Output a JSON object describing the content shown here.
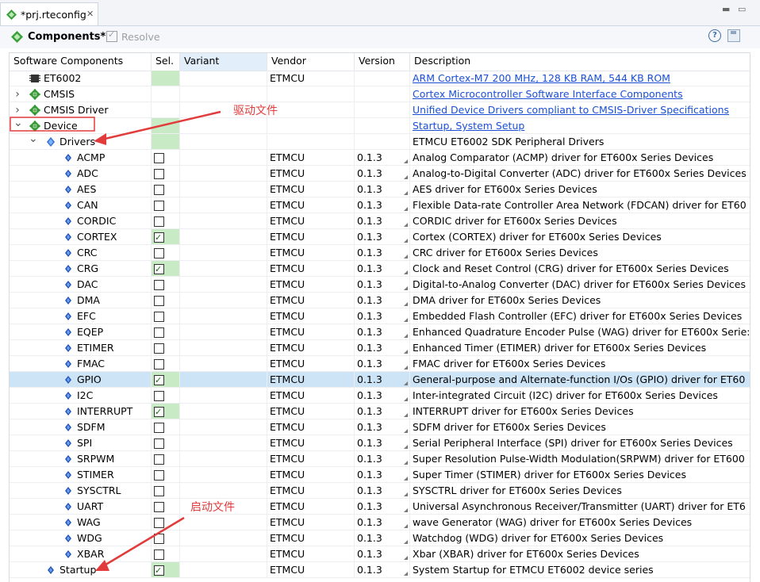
{
  "tab": {
    "title": "*prj.rteconfig",
    "close": "✕"
  },
  "header": {
    "title": "Components*",
    "resolve": "Resolve"
  },
  "columns": [
    "Software Components",
    "Sel.",
    "Variant",
    "Vendor",
    "Version",
    "Description"
  ],
  "rows": [
    {
      "name": "ET6002",
      "level": 0,
      "icon": "chip-icon",
      "expander": "",
      "sel": "green",
      "vendor": "ETMCU",
      "version": "",
      "desc": "ARM Cortex-M7 200 MHz, 128 KB RAM, 544 KB ROM",
      "link": true
    },
    {
      "name": "CMSIS",
      "level": 0,
      "icon": "component-diamond-icon",
      "expander": ">",
      "sel": "",
      "vendor": "",
      "version": "",
      "desc": "Cortex Microcontroller Software Interface Components",
      "link": true
    },
    {
      "name": "CMSIS Driver",
      "level": 0,
      "icon": "component-diamond-icon",
      "expander": ">",
      "sel": "",
      "vendor": "",
      "version": "",
      "desc": "Unified Device Drivers compliant to CMSIS-Driver Specifications",
      "link": true
    },
    {
      "name": "Device",
      "level": 0,
      "icon": "component-diamond-icon",
      "expander": "v",
      "sel": "green",
      "vendor": "",
      "version": "",
      "desc": "Startup, System Setup",
      "link": true,
      "boxed": true
    },
    {
      "name": "Drivers",
      "level": 1,
      "icon": "group-diamond-icon",
      "expander": "v",
      "sel": "green",
      "vendor": "",
      "version": "",
      "desc": "ETMCU ET6002 SDK Peripheral Drivers",
      "link": false
    },
    {
      "name": "ACMP",
      "level": 2,
      "icon": "driver-icon",
      "sel": "off",
      "vendor": "ETMCU",
      "version": "0.1.3",
      "desc": "Analog Comparator (ACMP) driver for ET600x Series Devices"
    },
    {
      "name": "ADC",
      "level": 2,
      "icon": "driver-icon",
      "sel": "off",
      "vendor": "ETMCU",
      "version": "0.1.3",
      "desc": "Analog-to-Digital Converter (ADC) driver for ET600x Series Devices"
    },
    {
      "name": "AES",
      "level": 2,
      "icon": "driver-icon",
      "sel": "off",
      "vendor": "ETMCU",
      "version": "0.1.3",
      "desc": "AES driver for ET600x Series Devices"
    },
    {
      "name": "CAN",
      "level": 2,
      "icon": "driver-icon",
      "sel": "off",
      "vendor": "ETMCU",
      "version": "0.1.3",
      "desc": "Flexible Data-rate Controller Area Network (FDCAN) driver for ET60"
    },
    {
      "name": "CORDIC",
      "level": 2,
      "icon": "driver-icon",
      "sel": "off",
      "vendor": "ETMCU",
      "version": "0.1.3",
      "desc": "CORDIC driver for ET600x Series Devices"
    },
    {
      "name": "CORTEX",
      "level": 2,
      "icon": "driver-icon",
      "sel": "on",
      "vendor": "ETMCU",
      "version": "0.1.3",
      "desc": "Cortex (CORTEX) driver for ET600x Series Devices"
    },
    {
      "name": "CRC",
      "level": 2,
      "icon": "driver-icon",
      "sel": "off",
      "vendor": "ETMCU",
      "version": "0.1.3",
      "desc": "CRC driver for ET600x Series Devices"
    },
    {
      "name": "CRG",
      "level": 2,
      "icon": "driver-icon",
      "sel": "on",
      "vendor": "ETMCU",
      "version": "0.1.3",
      "desc": "Clock and Reset Control (CRG) driver for ET600x Series Devices"
    },
    {
      "name": "DAC",
      "level": 2,
      "icon": "driver-icon",
      "sel": "off",
      "vendor": "ETMCU",
      "version": "0.1.3",
      "desc": "Digital-to-Analog Converter (DAC) driver for ET600x Series Devices"
    },
    {
      "name": "DMA",
      "level": 2,
      "icon": "driver-icon",
      "sel": "off",
      "vendor": "ETMCU",
      "version": "0.1.3",
      "desc": "DMA driver for ET600x Series Devices"
    },
    {
      "name": "EFC",
      "level": 2,
      "icon": "driver-icon",
      "sel": "off",
      "vendor": "ETMCU",
      "version": "0.1.3",
      "desc": "Embedded Flash Controller (EFC) driver for ET600x Series Devices"
    },
    {
      "name": "EQEP",
      "level": 2,
      "icon": "driver-icon",
      "sel": "off",
      "vendor": "ETMCU",
      "version": "0.1.3",
      "desc": "Enhanced Quadrature Encoder Pulse (WAG) driver for ET600x Serie:"
    },
    {
      "name": "ETIMER",
      "level": 2,
      "icon": "driver-icon",
      "sel": "off",
      "vendor": "ETMCU",
      "version": "0.1.3",
      "desc": "Enhanced Timer (ETIMER) driver for ET600x Series Devices"
    },
    {
      "name": "FMAC",
      "level": 2,
      "icon": "driver-icon",
      "sel": "off",
      "vendor": "ETMCU",
      "version": "0.1.3",
      "desc": "FMAC driver for ET600x Series Devices"
    },
    {
      "name": "GPIO",
      "level": 2,
      "icon": "driver-icon",
      "sel": "on",
      "vendor": "ETMCU",
      "version": "0.1.3",
      "desc": "General-purpose and Alternate-function I/Os (GPIO) driver for ET60",
      "selected": true
    },
    {
      "name": "I2C",
      "level": 2,
      "icon": "driver-icon",
      "sel": "off",
      "vendor": "ETMCU",
      "version": "0.1.3",
      "desc": "Inter-integrated Circuit (I2C) driver for ET600x Series Devices"
    },
    {
      "name": "INTERRUPT",
      "level": 2,
      "icon": "driver-icon",
      "sel": "on",
      "vendor": "ETMCU",
      "version": "0.1.3",
      "desc": "INTERRUPT driver for ET600x Series Devices"
    },
    {
      "name": "SDFM",
      "level": 2,
      "icon": "driver-icon",
      "sel": "off",
      "vendor": "ETMCU",
      "version": "0.1.3",
      "desc": "SDFM driver for ET600x Series Devices"
    },
    {
      "name": "SPI",
      "level": 2,
      "icon": "driver-icon",
      "sel": "off",
      "vendor": "ETMCU",
      "version": "0.1.3",
      "desc": "Serial Peripheral Interface (SPI) driver for ET600x Series Devices"
    },
    {
      "name": "SRPWM",
      "level": 2,
      "icon": "driver-icon",
      "sel": "off",
      "vendor": "ETMCU",
      "version": "0.1.3",
      "desc": "Super Resolution Pulse-Width Modulation(SRPWM) driver for ET600"
    },
    {
      "name": "STIMER",
      "level": 2,
      "icon": "driver-icon",
      "sel": "off",
      "vendor": "ETMCU",
      "version": "0.1.3",
      "desc": "Super Timer (STIMER) driver for ET600x Series Devices"
    },
    {
      "name": "SYSCTRL",
      "level": 2,
      "icon": "driver-icon",
      "sel": "off",
      "vendor": "ETMCU",
      "version": "0.1.3",
      "desc": "SYSCTRL driver for ET600x Series Devices"
    },
    {
      "name": "UART",
      "level": 2,
      "icon": "driver-icon",
      "sel": "off",
      "vendor": "ETMCU",
      "version": "0.1.3",
      "desc": "Universal Asynchronous Receiver/Transmitter (UART) driver for ET6"
    },
    {
      "name": "WAG",
      "level": 2,
      "icon": "driver-icon",
      "sel": "off",
      "vendor": "ETMCU",
      "version": "0.1.3",
      "desc": "wave Generator (WAG) driver for ET600x Series Devices"
    },
    {
      "name": "WDG",
      "level": 2,
      "icon": "driver-icon",
      "sel": "off",
      "vendor": "ETMCU",
      "version": "0.1.3",
      "desc": "Watchdog (WDG) driver for ET600x Series Devices"
    },
    {
      "name": "XBAR",
      "level": 2,
      "icon": "driver-icon",
      "sel": "off",
      "vendor": "ETMCU",
      "version": "0.1.3",
      "desc": "Xbar (XBAR) driver for ET600x Series Devices"
    },
    {
      "name": "Startup",
      "level": 1,
      "icon": "driver-icon",
      "expander": "",
      "sel": "on",
      "vendor": "ETMCU",
      "version": "0.1.3",
      "desc": "System Startup for ETMCU ET6002 device series"
    }
  ],
  "annotations": {
    "drivers_label": "驱动文件",
    "startup_label": "启动文件"
  },
  "colors": {
    "accent_green": "#3aa13a",
    "selection": "#cde4f7",
    "sel_green": "#c8ebc5",
    "link": "#1a4fd6",
    "annotation": "#e23b3b"
  }
}
